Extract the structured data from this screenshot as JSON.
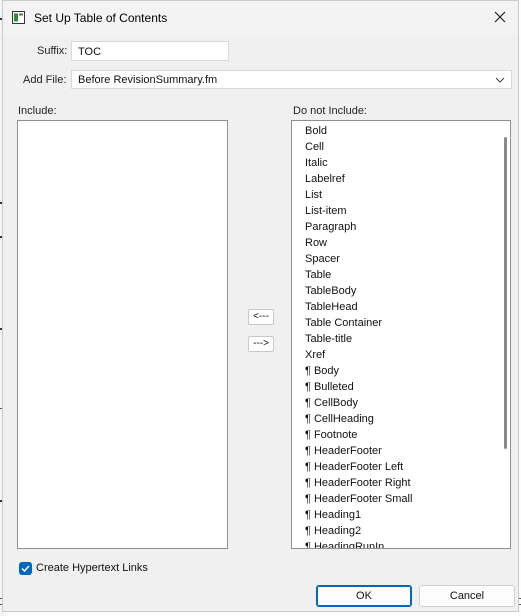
{
  "window": {
    "title": "Set Up Table of Contents"
  },
  "suffix": {
    "label": "Suffix:",
    "value": "TOC"
  },
  "add_file": {
    "label": "Add File:",
    "value": "Before RevisionSummary.fm"
  },
  "include": {
    "label": "Include:",
    "items": []
  },
  "exclude": {
    "label": "Do not Include:",
    "items": [
      "Bold",
      "Cell",
      "Italic",
      "Labelref",
      "List",
      "List-item",
      "Paragraph",
      "Row",
      "Spacer",
      "Table",
      "TableBody",
      "TableHead",
      "Table Container",
      "Table-title",
      "Xref",
      "¶ Body",
      "¶ Bulleted",
      "¶ CellBody",
      "¶ CellHeading",
      "¶ Footnote",
      "¶ HeaderFooter",
      "¶ HeaderFooter Left",
      "¶ HeaderFooter Right",
      "¶ HeaderFooter Small",
      "¶ Heading1",
      "¶ Heading2",
      "¶ HeadingRunIn"
    ]
  },
  "move_buttons": {
    "to_include": "<---",
    "to_exclude": "--->"
  },
  "hypertext": {
    "label": "Create Hypertext Links",
    "checked": true
  },
  "footer": {
    "ok": "OK",
    "cancel": "Cancel"
  },
  "colors": {
    "accent": "#0067c0"
  }
}
